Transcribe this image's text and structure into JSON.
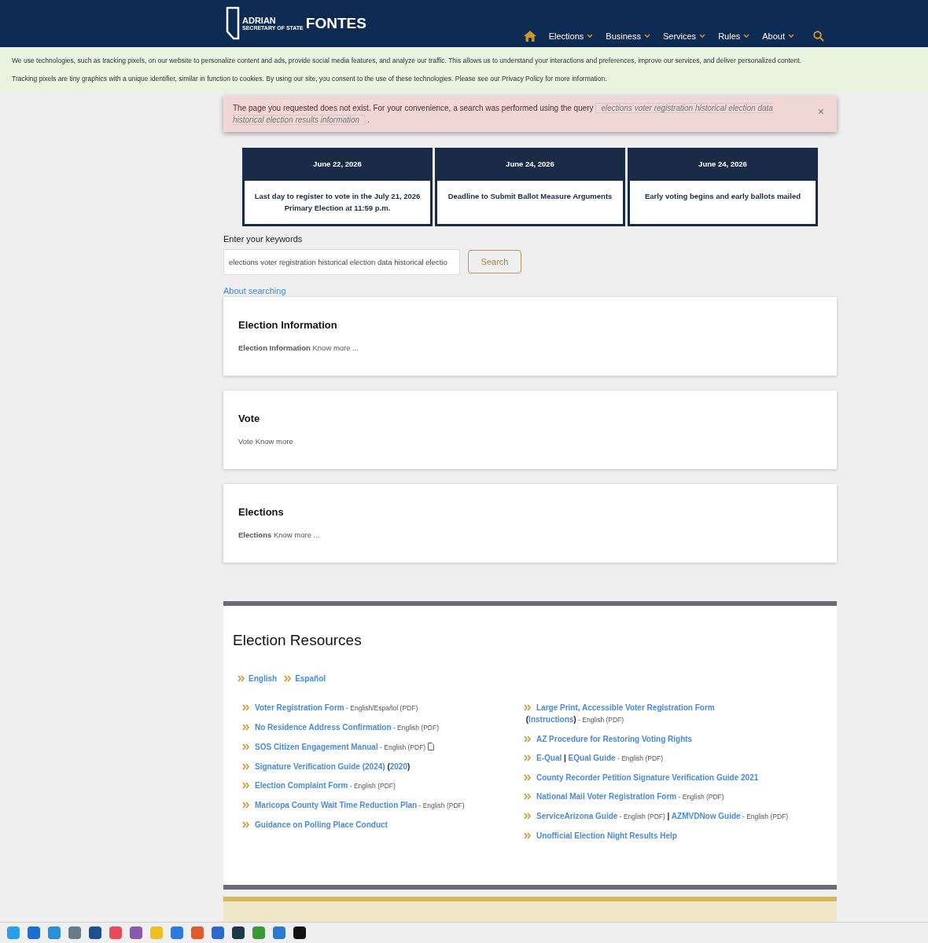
{
  "header": {
    "logo": {
      "name_first": "ADRIAN",
      "name_last": "FONTES",
      "subtitle": "SECRETARY OF STATE"
    },
    "nav": [
      {
        "label": "Elections"
      },
      {
        "label": "Business"
      },
      {
        "label": "Services"
      },
      {
        "label": "Rules"
      },
      {
        "label": "About"
      }
    ]
  },
  "cookie_notice": [
    "We use technologies, such as tracking pixels, on our website to personalize content and ads, provide social media features, and analyze our traffic. This allows us to understand your interactions and preferences, improve our services, and deliver personalized content.",
    "Tracking pixels are tiny graphics with a unique identifier, similar in function to cookies. By using our site, you consent to the use of these technologies. Please see our Privacy Policy for more information."
  ],
  "alert": {
    "message": "The page you requested does not exist. For your convenience, a search was performed using the query",
    "query": "elections voter registration historical election data historical election results information",
    "end": ".",
    "close": "×"
  },
  "dates": [
    {
      "date": "June 22, 2026",
      "event": "Last day to register to vote in the July 21, 2026 Primary Election at 11:59 p.m."
    },
    {
      "date": "June 24, 2026",
      "event": "Deadline to Submit Ballot Measure Arguments"
    },
    {
      "date": "June 24, 2026",
      "event": "Early voting begins and early ballots mailed"
    }
  ],
  "search": {
    "label": "Enter your keywords",
    "value": "elections voter registration historical election data historical electio",
    "button": "Search",
    "help_link": "About searching"
  },
  "results": [
    {
      "title": "Election Information",
      "snippet": "**Election Information** Know more ..."
    },
    {
      "title": "Vote",
      "snippet": "Vote Know more"
    },
    {
      "title": "Elections",
      "snippet": "**Elections** Know more ..."
    }
  ],
  "resources": {
    "title": "Election Resources",
    "languages": [
      {
        "label": "English"
      },
      {
        "label": "Español"
      }
    ],
    "columns": [
      [
        {
          "parts": [
            {
              "kind": "link",
              "text": "Voter Registration Form"
            },
            {
              "kind": "note",
              "text": " - English/Español (PDF)"
            }
          ]
        },
        {
          "parts": [
            {
              "kind": "link",
              "text": "No Residence Address Confirmation"
            },
            {
              "kind": "note",
              "text": " - English (PDF)"
            }
          ]
        },
        {
          "parts": [
            {
              "kind": "link",
              "text": "SOS Citizen Engagement Manual"
            },
            {
              "kind": "note",
              "text": " - English (PDF)"
            },
            {
              "kind": "file-icon"
            }
          ]
        },
        {
          "parts": [
            {
              "kind": "link",
              "text": "Signature Verification Guide (2024)"
            },
            {
              "kind": "plain",
              "text": " ("
            },
            {
              "kind": "link",
              "text": "2020"
            },
            {
              "kind": "plain",
              "text": ")"
            }
          ]
        },
        {
          "parts": [
            {
              "kind": "link",
              "text": "Election Complaint Form"
            },
            {
              "kind": "note",
              "text": " - English (PDF)"
            }
          ]
        },
        {
          "parts": [
            {
              "kind": "link",
              "text": "Maricopa County Wait Time Reduction Plan"
            },
            {
              "kind": "note",
              "text": " - English (PDF)"
            }
          ]
        },
        {
          "parts": [
            {
              "kind": "link",
              "text": "Guidance on Polling Place Conduct"
            }
          ]
        }
      ],
      [
        {
          "parts": [
            {
              "kind": "link",
              "text": "Large Print, Accessible Voter Registration Form"
            },
            {
              "kind": "plain",
              "text": " ("
            },
            {
              "kind": "link",
              "text": "Instructions"
            },
            {
              "kind": "plain",
              "text": ")"
            },
            {
              "kind": "note",
              "text": " - English (PDF)"
            }
          ]
        },
        {
          "parts": [
            {
              "kind": "link",
              "text": "AZ Procedure for Restoring Voting Rights"
            }
          ]
        },
        {
          "parts": [
            {
              "kind": "link",
              "text": "E-Qual"
            },
            {
              "kind": "plain",
              "text": " | "
            },
            {
              "kind": "link",
              "text": "EQual Guide"
            },
            {
              "kind": "note",
              "text": " - English (PDF)"
            }
          ]
        },
        {
          "parts": [
            {
              "kind": "link",
              "text": "County Recorder Petition Signature Verification Guide 2021"
            }
          ]
        },
        {
          "parts": [
            {
              "kind": "link",
              "text": "National Mail Voter Registration Form"
            },
            {
              "kind": "note",
              "text": " - English (PDF)"
            }
          ]
        },
        {
          "parts": [
            {
              "kind": "link",
              "text": "ServiceArizona Guide"
            },
            {
              "kind": "note",
              "text": " - English (PDF)"
            },
            {
              "kind": "plain",
              "text": " | "
            },
            {
              "kind": "link",
              "text": "AZMVDNow Guide"
            },
            {
              "kind": "note",
              "text": " - English (PDF)"
            }
          ]
        },
        {
          "parts": [
            {
              "kind": "link",
              "text": "Unofficial Election Night Results Help"
            }
          ]
        }
      ]
    ]
  },
  "taskbar": [
    {
      "color": "#2a9ee8"
    },
    {
      "color": "#1a6fd0"
    },
    {
      "color": "#2a8fd8"
    },
    {
      "color": "#6a7a8a"
    },
    {
      "color": "#1f4f8f"
    },
    {
      "color": "#e84a5a"
    },
    {
      "color": "#8a5ab0"
    },
    {
      "color": "#f0c020"
    },
    {
      "color": "#2a7ae0"
    },
    {
      "color": "#e05a30"
    },
    {
      "color": "#2a6ad0"
    },
    {
      "color": "#1a3a4a"
    },
    {
      "color": "#3a9a3a"
    },
    {
      "color": "#2a7ad0"
    },
    {
      "color": "#111111"
    }
  ]
}
